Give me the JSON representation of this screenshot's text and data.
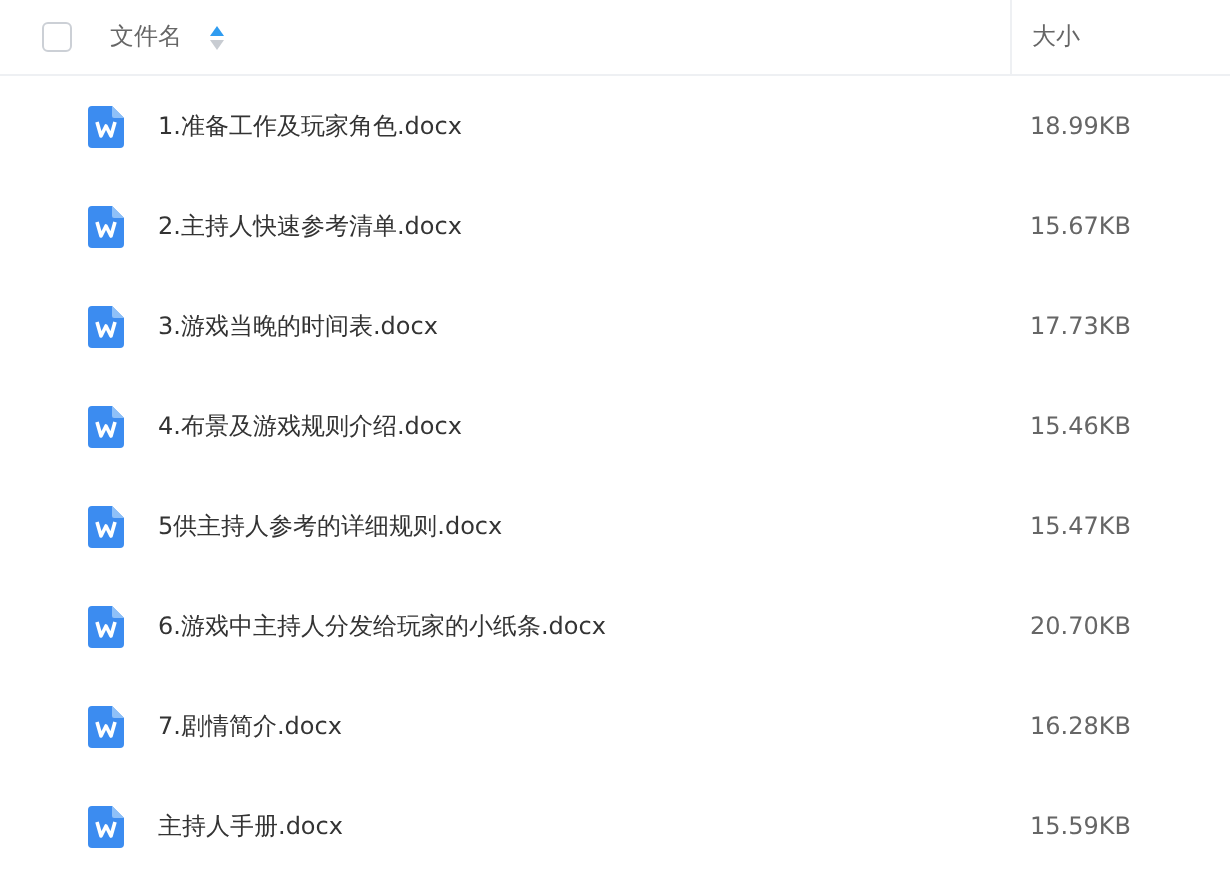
{
  "table": {
    "header": {
      "checked": false,
      "columns": [
        {
          "label": "文件名",
          "sorted_ascending": true
        },
        {
          "label": "大小"
        }
      ]
    },
    "rows": [
      {
        "name": "1.准备工作及玩家角色.docx",
        "size": "18.99KB"
      },
      {
        "name": "2.主持人快速参考清单.docx",
        "size": "15.67KB"
      },
      {
        "name": "3.游戏当晚的时间表.docx",
        "size": "17.73KB"
      },
      {
        "name": "4.布景及游戏规则介绍.docx",
        "size": "15.46KB"
      },
      {
        "name": "5供主持人参考的详细规则.docx",
        "size": "15.47KB"
      },
      {
        "name": "6.游戏中主持人分发给玩家的小纸条.docx",
        "size": "20.70KB"
      },
      {
        "name": "7.剧情简介.docx",
        "size": "16.28KB"
      },
      {
        "name": "主持人手册.docx",
        "size": "15.59KB"
      }
    ]
  }
}
